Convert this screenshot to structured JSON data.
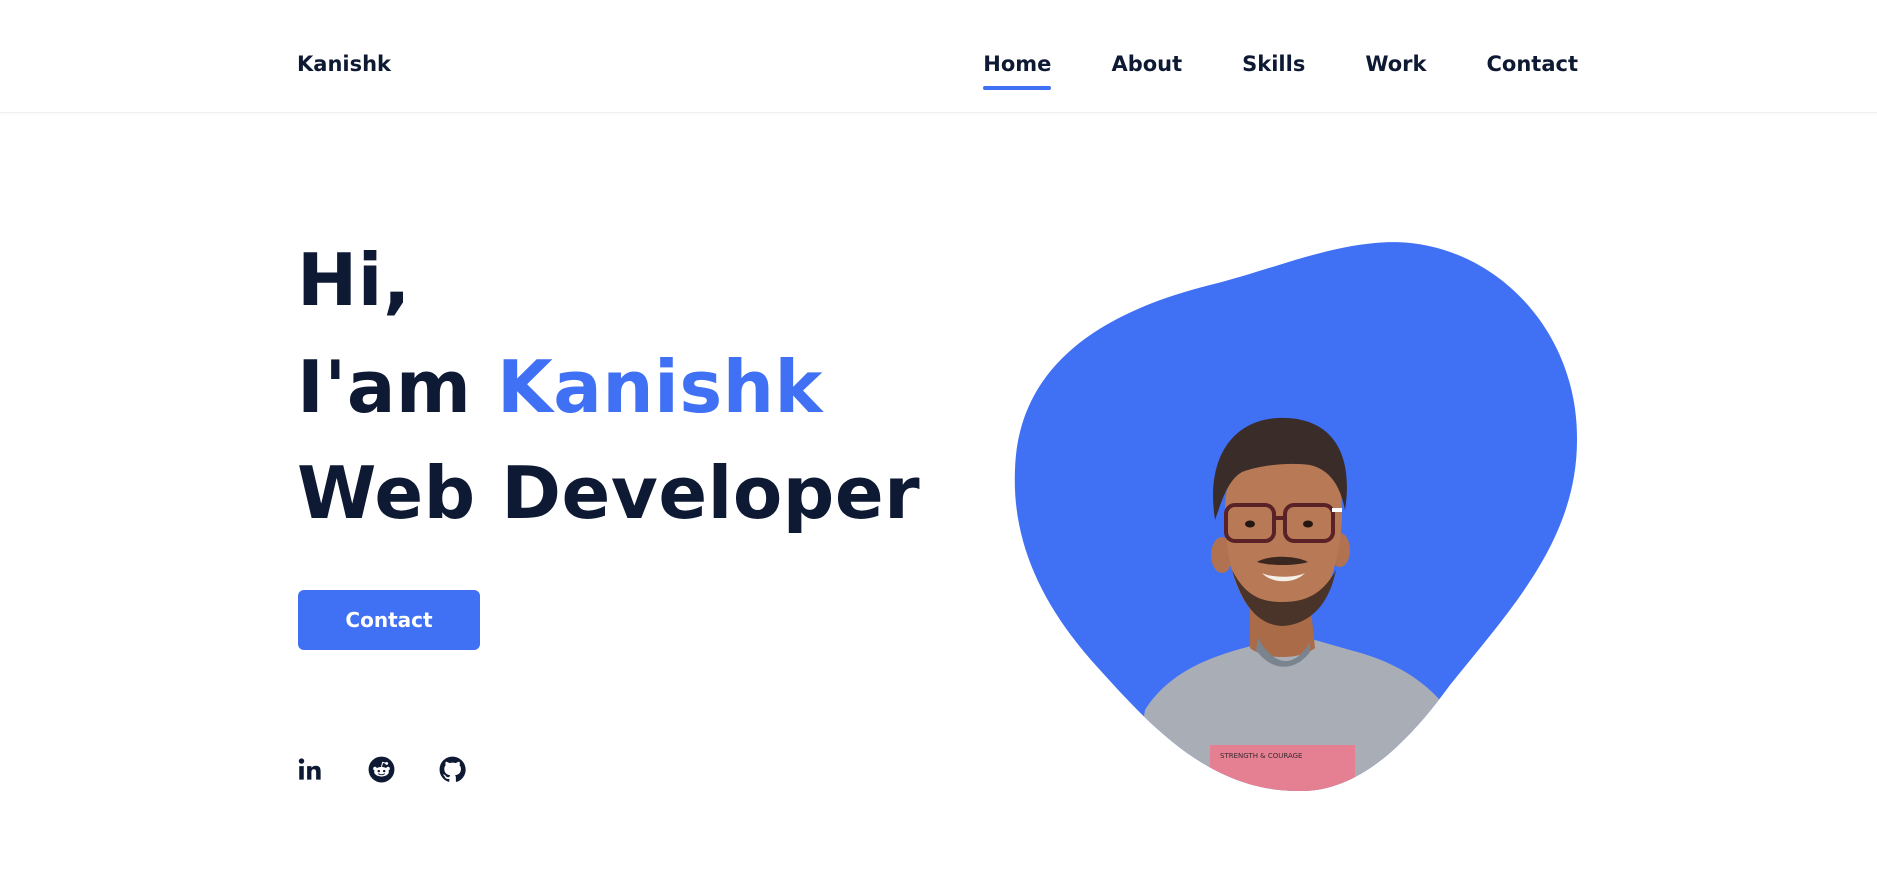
{
  "header": {
    "logo": "Kanishk",
    "nav": [
      {
        "label": "Home",
        "active": true
      },
      {
        "label": "About",
        "active": false
      },
      {
        "label": "Skills",
        "active": false
      },
      {
        "label": "Work",
        "active": false
      },
      {
        "label": "Contact",
        "active": false
      }
    ]
  },
  "hero": {
    "greeting": "Hi,",
    "intro_prefix": "I'am ",
    "name": "Kanishk",
    "role": "Web Developer",
    "button_label": "Contact",
    "socials": [
      {
        "icon": "linkedin-icon"
      },
      {
        "icon": "reddit-icon"
      },
      {
        "icon": "github-icon"
      }
    ],
    "photo_alt": "profile photo",
    "shirt_text": "STRENGTH & COURAGE"
  },
  "colors": {
    "accent": "#4070f4",
    "text": "#0e1a33",
    "background": "#ffffff"
  }
}
